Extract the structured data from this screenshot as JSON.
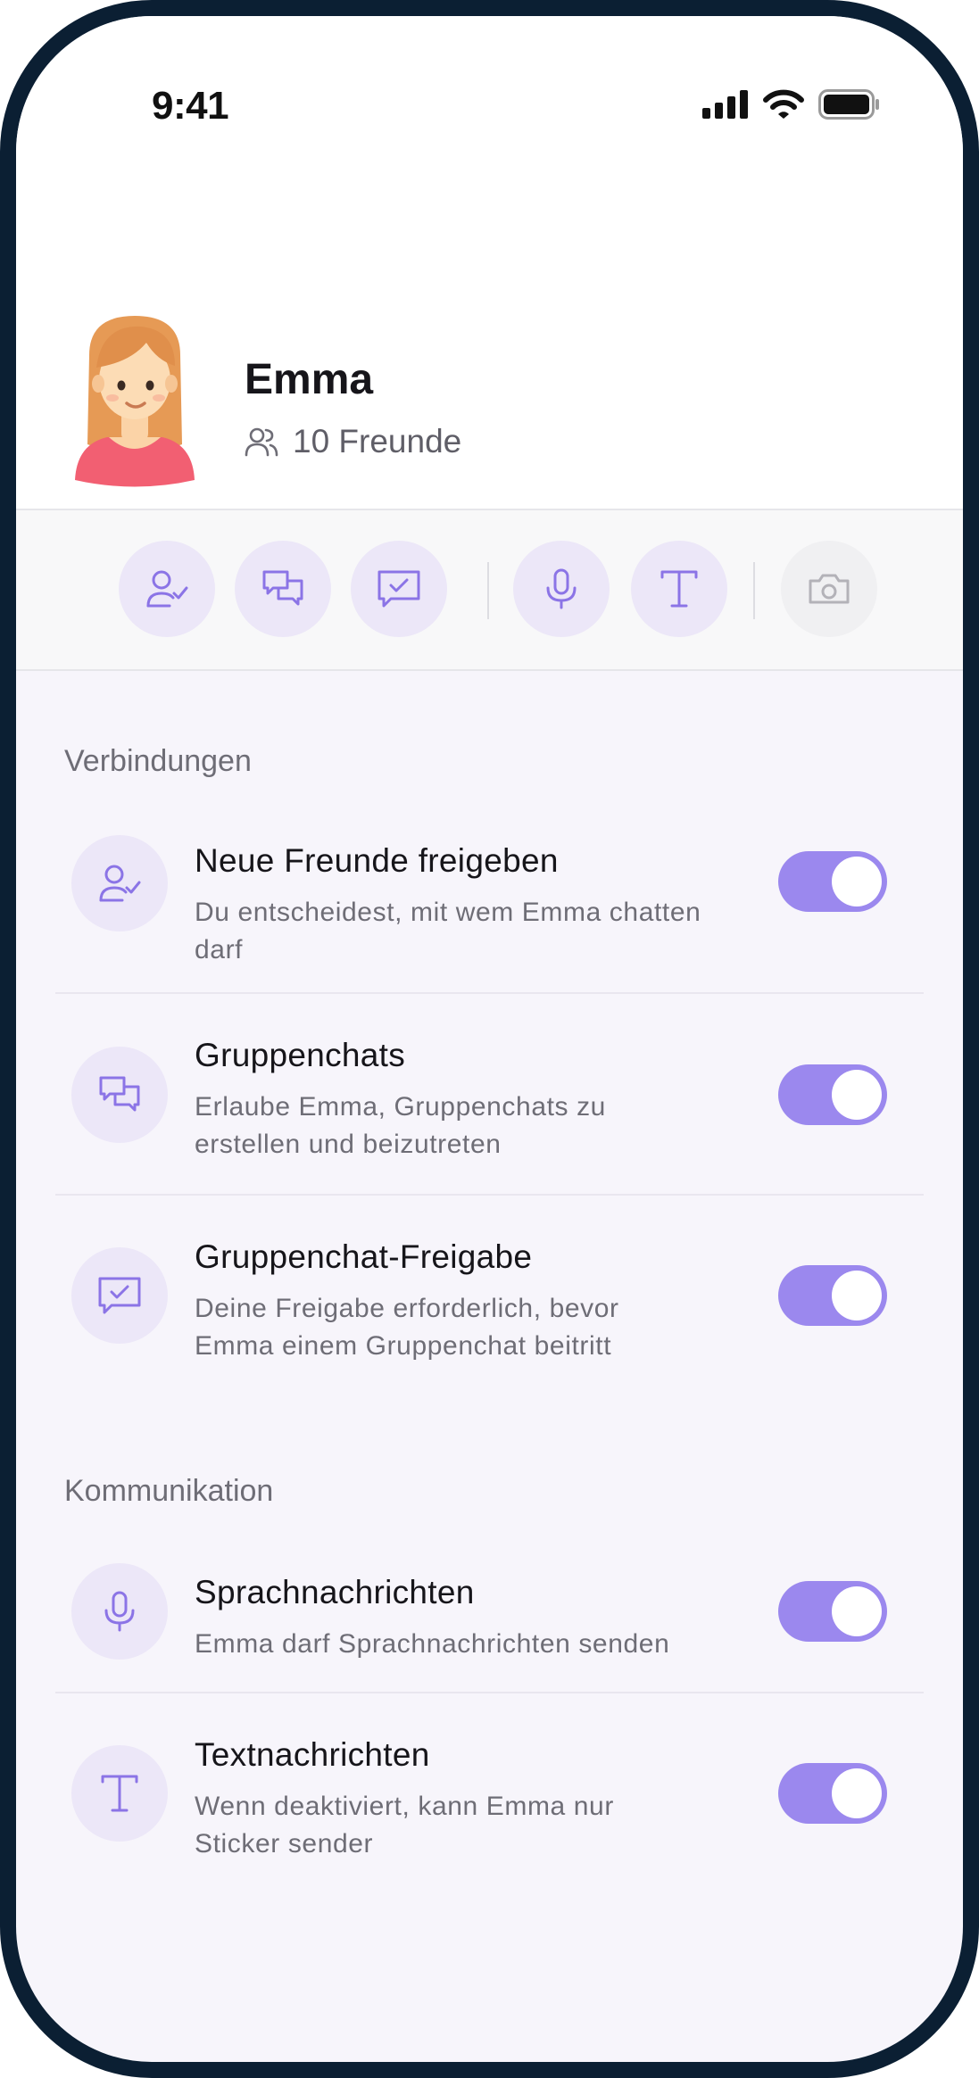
{
  "status_bar": {
    "time": "9:41"
  },
  "profile": {
    "name": "Emma",
    "friends": "10 Freunde"
  },
  "toolbar": {
    "buttons": [
      {
        "icon": "user-check-icon",
        "enabled": true
      },
      {
        "icon": "chat-bubbles-icon",
        "enabled": true
      },
      {
        "icon": "chat-check-icon",
        "enabled": true
      },
      {
        "icon": "microphone-icon",
        "enabled": true
      },
      {
        "icon": "text-icon",
        "enabled": true
      },
      {
        "icon": "camera-icon",
        "enabled": false
      }
    ]
  },
  "sections": [
    {
      "heading": "Verbindungen",
      "items": [
        {
          "icon": "user-check-icon",
          "title": "Neue Freunde freigeben",
          "description": "Du entscheidest, mit wem Emma chatten darf",
          "enabled": true
        },
        {
          "icon": "chat-bubbles-icon",
          "title": "Gruppenchats",
          "description": "Erlaube Emma, Gruppenchats zu erstellen und beizutreten",
          "enabled": true
        },
        {
          "icon": "chat-check-icon",
          "title": "Gruppenchat-Freigabe",
          "description": "Deine Freigabe erforderlich, bevor Emma einem Gruppenchat beitritt",
          "enabled": true
        }
      ]
    },
    {
      "heading": "Kommunikation",
      "items": [
        {
          "icon": "microphone-icon",
          "title": "Sprachnachrichten",
          "description": "Emma darf Sprachnachrichten senden",
          "enabled": true
        },
        {
          "icon": "text-icon",
          "title": "Textnachrichten",
          "description": "Wenn deaktiviert, kann Emma nur Sticker sender",
          "enabled": true
        }
      ]
    }
  ],
  "colors": {
    "accent": "#9b88ee",
    "icon_stroke": "#8b74e6",
    "icon_background": "#ece7f8",
    "page_background": "#f7f5fb",
    "frame": "#0b1f33"
  }
}
